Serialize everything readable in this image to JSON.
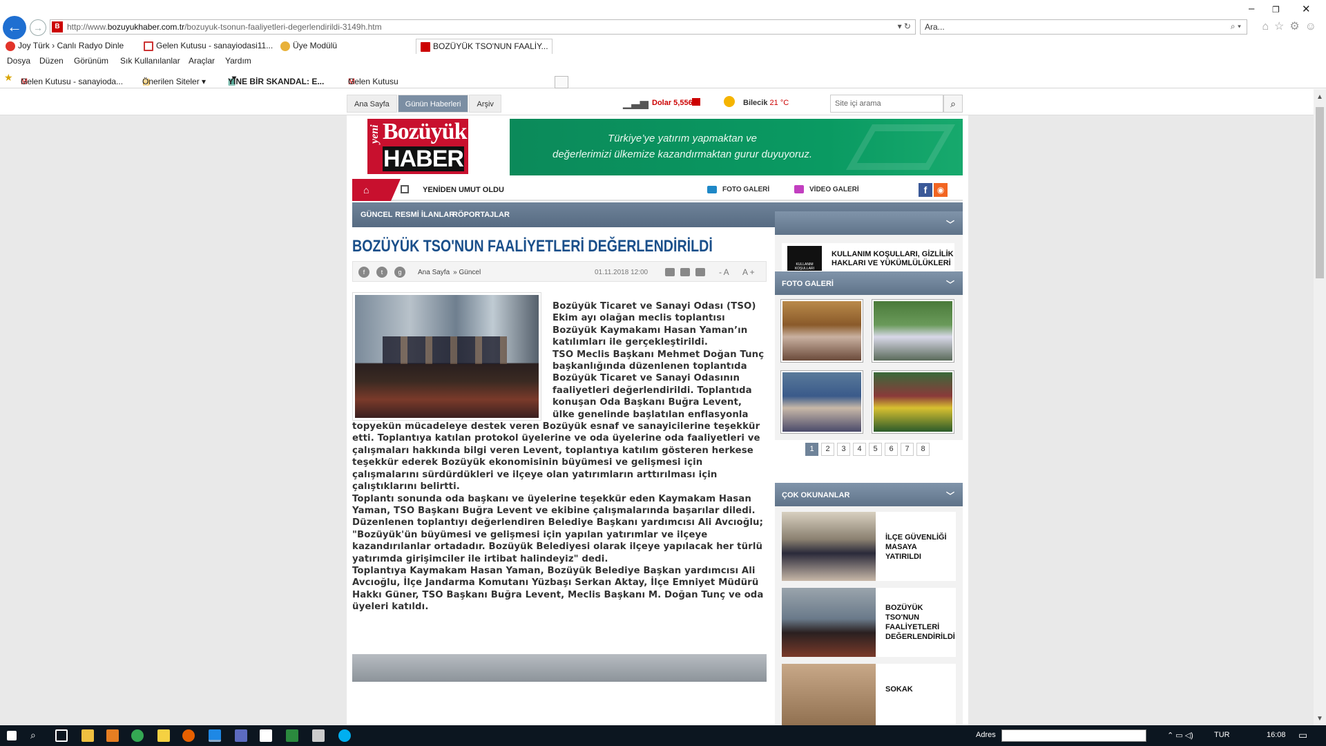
{
  "browser": {
    "url_prefix": "http://www.",
    "url_domain": "bozuyukhaber.com.tr",
    "url_path": "/bozuyuk-tsonun-faaliyetleri-degerlendirildi-3149h.htm",
    "search_placeholder": "Ara...",
    "tabs": [
      {
        "label": "Joy Türk › Canlı Radyo Dinle",
        "icon_color": "#e2342a"
      },
      {
        "label": "Gelen Kutusu - sanayiodasi11...",
        "icon_color": "#c33"
      },
      {
        "label": "Üye Modülü",
        "icon_color": "#e8b13a"
      },
      {
        "label": "BOZÜYÜK TSO'NUN FAALİY...",
        "icon_color": "#c00",
        "close": "×"
      }
    ],
    "menu": [
      "Dosya",
      "Düzen",
      "Görünüm",
      "Sık Kullanılanlar",
      "Araçlar",
      "Yardım"
    ],
    "favorites": [
      {
        "label": "Gelen Kutusu - sanayioda..."
      },
      {
        "label": "Önerilen Siteler ▾"
      },
      {
        "label": "YİNE BİR SKANDAL: E..."
      },
      {
        "label": "Gelen Kutusu"
      }
    ]
  },
  "site": {
    "topnav": [
      "Ana Sayfa",
      "Günün Haberleri",
      "Arşiv"
    ],
    "dolar_label": "Dolar 5,5568",
    "city": "Bilecik",
    "temp": "21 °C",
    "search_placeholder": "Site içi arama",
    "logo_yeni": "yeni",
    "logo_top": "Bozüyük",
    "logo_bottom": "HABER",
    "banner_line1": "Türkiye’ye yatırım yapmaktan ve",
    "banner_line2": "değerlerimizi ülkemize kazandırmaktan gurur duyuyoruz.",
    "ticker": "YENİDEN UMUT OLDU",
    "foto_galeri": "FOTO GALERİ",
    "video_galeri": "VİDEO GALERİ",
    "categories": [
      "GÜNCEL",
      "RESMİ İLANLAR",
      "RÖPORTAJLAR"
    ]
  },
  "article": {
    "title": "BOZÜYÜK TSO'NUN FAALİYETLERİ DEĞERLENDİRİLDİ",
    "breadcrumb": [
      "Ana Sayfa",
      "» Güncel"
    ],
    "date": "01.11.2018 12:00",
    "font_minus": "- A",
    "font_plus": "A +",
    "paragraphs": [
      "Bozüyük Ticaret ve Sanayi Odası (TSO) Ekim ayı olağan meclis toplantısı Bozüyük Kaymakamı Hasan Yaman’ın katılımları ile gerçekleştirildi.",
      "TSO Meclis Başkanı Mehmet Doğan Tunç başkanlığında düzenlenen toplantıda Bozüyük Ticaret ve Sanayi Odasının faaliyetleri değerlendirildi. Toplantıda konuşan Oda Başkanı Buğra Levent, ülke genelinde başlatılan enflasyonla topyekün mücadeleye destek veren Bozüyük esnaf ve sanayicilerine teşekkür etti. Toplantıya katılan protokol üyelerine ve oda üyelerine oda faaliyetleri ve çalışmaları hakkında bilgi veren Levent, toplantıya katılım gösteren herkese teşekkür ederek Bozüyük ekonomisinin büyümesi ve gelişmesi için çalışmalarını sürdürdükleri ve ilçeye olan yatırımların arttırılması için çalıştıklarını belirtti.",
      "Toplantı sonunda oda başkanı ve üyelerine teşekkür eden Kaymakam Hasan Yaman, TSO Başkanı Buğra Levent ve ekibine çalışmalarında başarılar diledi.",
      "Düzenlenen toplantıyı değerlendiren Belediye Başkanı yardımcısı Ali Avcıoğlu; \"Bozüyük'ün büyümesi ve gelişmesi için yapılan yatırımlar ve ilçeye kazandırılanlar ortadadır. Bozüyük Belediyesi olarak ilçeye yapılacak her türlü yatırımda girişimciler ile irtibat halindeyiz\" dedi.",
      "Toplantıya Kaymakam Hasan Yaman, Bozüyük Belediye Başkan yardımcısı Ali Avcıoğlu, İlçe Jandarma Komutanı Yüzbaşı Serkan Aktay, İlçe Emniyet Müdürü Hakkı Güner, TSO Başkanı Buğra Levent, Meclis Başkanı M. Doğan Tunç ve oda üyeleri katıldı."
    ]
  },
  "sidebar": {
    "rules_icon_text": "KULLANIM KOŞULLARI",
    "rules_line1": "KULLANIM KOŞULLARI, GİZLİLİK",
    "rules_line2": "HAKLARI VE YÜKÜMLÜLÜKLERİ",
    "foto_galeri_title": "FOTO GALERİ",
    "pages": [
      "1",
      "2",
      "3",
      "4",
      "5",
      "6",
      "7",
      "8"
    ],
    "cok_okunanlar_title": "ÇOK OKUNANLAR",
    "popular": [
      {
        "title": "İLÇE GÜVENLİĞİ MASAYA YATIRILDI"
      },
      {
        "title": "BOZÜYÜK TSO'NUN FAALİYETLERİ DEĞERLENDİRİLDİ"
      },
      {
        "title": "SOKAK"
      }
    ]
  },
  "taskbar": {
    "adres_label": "Adres",
    "lang": "TUR",
    "time": "16:08"
  }
}
